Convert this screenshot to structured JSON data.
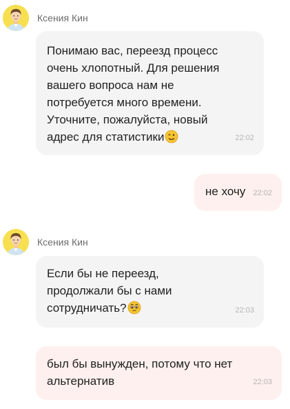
{
  "messages": [
    {
      "sender": "Ксения Кин",
      "avatar_icon": "male-agent-avatar",
      "text": "Понимаю вас, переезд процесс\nочень хлопотный. Для решения\nвашего вопроса нам не\nпотребуется много времени.\nУточните, пожалуйста, новый\nадрес для статистики",
      "emoji": "winking-face",
      "time": "22:02",
      "direction": "incoming"
    },
    {
      "text": "не хочу",
      "time": "22:02",
      "direction": "outgoing"
    },
    {
      "sender": "Ксения Кин",
      "avatar_icon": "male-agent-avatar",
      "text": "Если бы не переезд,\nпродолжали бы с нами\nсотрудничать?",
      "emoji": "pleading-face",
      "time": "22:03",
      "direction": "incoming"
    },
    {
      "text": "был бы вынужден, потому что нет\nальтернатив",
      "time": "22:03",
      "direction": "outgoing"
    }
  ],
  "colors": {
    "incoming_bubble": "#f4f4f4",
    "outgoing_bubble": "#fdf0ee",
    "avatar_bg": "#f7df50",
    "time_text": "#b5b5b5"
  }
}
